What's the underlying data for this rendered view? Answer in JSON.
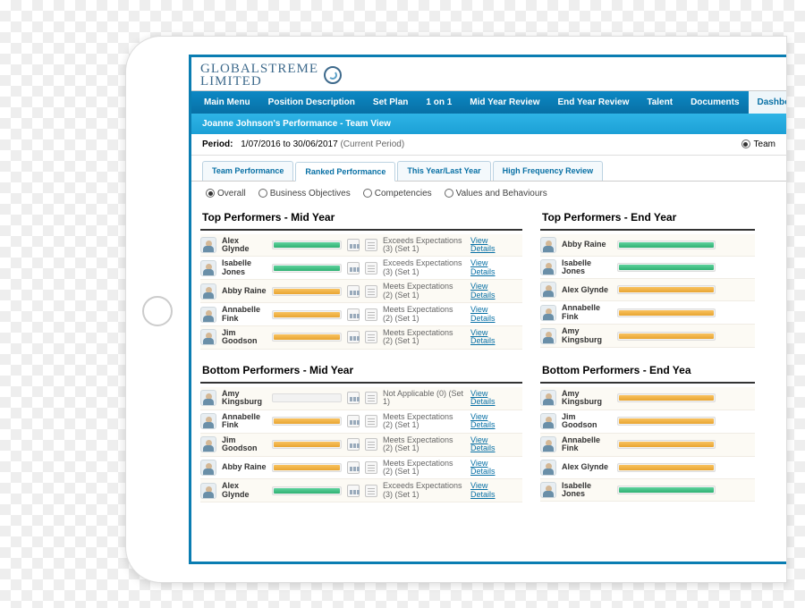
{
  "logo": {
    "line1": "GLOBALSTREME",
    "line2": "LIMITED"
  },
  "nav": {
    "items": [
      "Main Menu",
      "Position Description",
      "Set Plan",
      "1 on 1",
      "Mid Year Review",
      "End Year Review",
      "Talent",
      "Documents",
      "Dashboa"
    ],
    "active_index": 8
  },
  "subheader": "Joanne Johnson's Performance - Team View",
  "period": {
    "label": "Period:",
    "value": "1/07/2016 to 30/06/2017",
    "suffix": "(Current Period)",
    "right_option": "Team"
  },
  "tabs": {
    "items": [
      "Team Performance",
      "Ranked Performance",
      "This Year/Last Year",
      "High Frequency Review"
    ],
    "active_index": 1
  },
  "filters": {
    "options": [
      "Overall",
      "Business Objectives",
      "Competencies",
      "Values and Behaviours"
    ],
    "selected_index": 0
  },
  "ratings": {
    "exceeds": "Exceeds Expectations (3) (Set 1)",
    "meets": "Meets Expectations (2) (Set 1)",
    "na": "Not Applicable (0) (Set 1)"
  },
  "link_view": "View",
  "link_details": "Details",
  "sections": {
    "top_mid": {
      "title": "Top Performers - Mid Year",
      "rows": [
        {
          "name": "Alex Glynde",
          "bar": "green",
          "rating": "exceeds"
        },
        {
          "name": "Isabelle Jones",
          "bar": "green",
          "rating": "exceeds"
        },
        {
          "name": "Abby Raine",
          "bar": "orange",
          "rating": "meets"
        },
        {
          "name": "Annabelle Fink",
          "bar": "orange",
          "rating": "meets"
        },
        {
          "name": "Jim Goodson",
          "bar": "orange",
          "rating": "meets"
        }
      ]
    },
    "top_end": {
      "title": "Top Performers - End Year",
      "rows": [
        {
          "name": "Abby Raine",
          "bar": "green"
        },
        {
          "name": "Isabelle Jones",
          "bar": "green"
        },
        {
          "name": "Alex Glynde",
          "bar": "orange"
        },
        {
          "name": "Annabelle Fink",
          "bar": "orange"
        },
        {
          "name": "Amy Kingsburg",
          "bar": "orange"
        }
      ]
    },
    "bot_mid": {
      "title": "Bottom Performers - Mid Year",
      "rows": [
        {
          "name": "Amy Kingsburg",
          "bar": "na",
          "rating": "na"
        },
        {
          "name": "Annabelle Fink",
          "bar": "orange",
          "rating": "meets"
        },
        {
          "name": "Jim Goodson",
          "bar": "orange",
          "rating": "meets"
        },
        {
          "name": "Abby Raine",
          "bar": "orange",
          "rating": "meets"
        },
        {
          "name": "Alex Glynde",
          "bar": "green",
          "rating": "exceeds"
        }
      ]
    },
    "bot_end": {
      "title": "Bottom Performers - End Yea",
      "rows": [
        {
          "name": "Amy Kingsburg",
          "bar": "orange"
        },
        {
          "name": "Jim Goodson",
          "bar": "orange"
        },
        {
          "name": "Annabelle Fink",
          "bar": "orange"
        },
        {
          "name": "Alex Glynde",
          "bar": "orange"
        },
        {
          "name": "Isabelle Jones",
          "bar": "green"
        }
      ]
    }
  }
}
